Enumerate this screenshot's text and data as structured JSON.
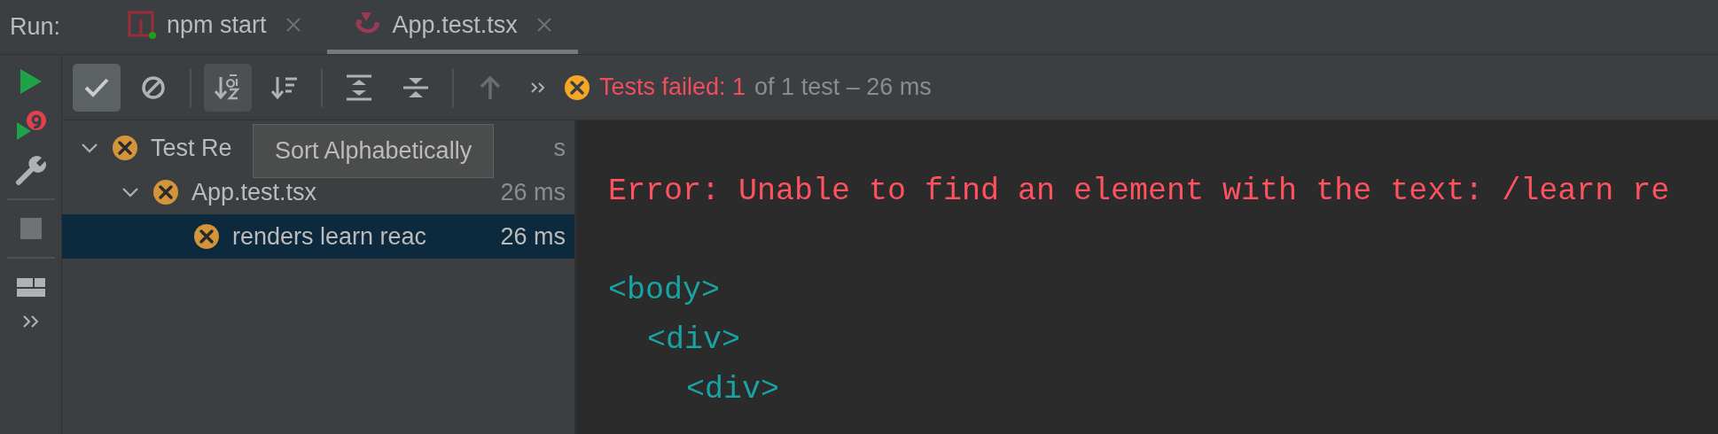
{
  "run_label": "Run:",
  "tabs": [
    {
      "label": "npm start",
      "kind": "npm",
      "selected": false
    },
    {
      "label": "App.test.tsx",
      "kind": "jest",
      "selected": true
    }
  ],
  "side_toolbar": [
    {
      "kind": "run",
      "disabled": false
    },
    {
      "kind": "rerun",
      "disabled": false
    },
    {
      "kind": "wrench",
      "disabled": false
    },
    {
      "kind": "stop",
      "disabled": true
    },
    {
      "kind": "layout",
      "disabled": false
    },
    {
      "kind": "more",
      "disabled": false
    }
  ],
  "toolbar": [
    {
      "kind": "check",
      "selected": true
    },
    {
      "kind": "ban",
      "selected": false
    },
    {
      "kind": "sort-alpha",
      "selected": true
    },
    {
      "kind": "sort-duration",
      "selected": false
    },
    {
      "kind": "expand",
      "selected": false
    },
    {
      "kind": "collapse",
      "selected": false
    },
    {
      "kind": "up",
      "selected": false,
      "disabled": true
    },
    {
      "kind": "more",
      "selected": false
    }
  ],
  "status": {
    "failed": "Tests failed: 1",
    "rest": "of 1 test – 26 ms"
  },
  "tree": [
    {
      "label": "Test Re",
      "time": "s",
      "expanded": true,
      "selected": false,
      "children": [
        {
          "label": "App.test.tsx",
          "time": "26 ms",
          "expanded": true,
          "selected": false,
          "children": [
            {
              "label": "renders learn reac",
              "time": "26 ms",
              "selected": true
            }
          ]
        }
      ]
    }
  ],
  "tooltip": "Sort Alphabetically",
  "console": [
    {
      "kind": "error",
      "text": "Error: Unable to find an element with the text: /learn re"
    },
    {
      "kind": "tag",
      "text": "<body>",
      "children": [
        {
          "kind": "tag",
          "text": "<div>",
          "children": [
            {
              "kind": "tag",
              "text": "<div>"
            }
          ]
        }
      ]
    }
  ]
}
